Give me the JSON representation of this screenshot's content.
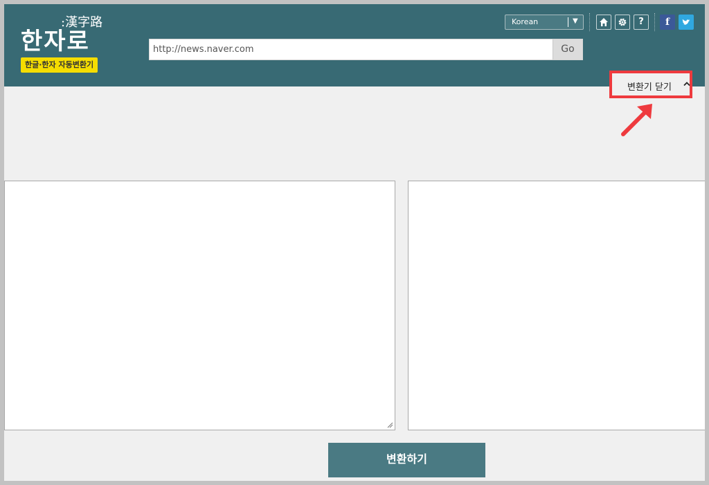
{
  "header": {
    "logo_hanja": ":漢字路",
    "logo_title": "한자로",
    "logo_badge": "한글·한자 자동변환기",
    "url_value": "http://news.naver.com",
    "go_label": "Go",
    "language": {
      "selected": "Korean"
    },
    "icons": [
      "home-icon",
      "gear-icon",
      "help-icon",
      "facebook-icon",
      "twitter-icon"
    ],
    "help_glyph": "?",
    "facebook_glyph": "f"
  },
  "converter": {
    "toggle_label": "변환기 닫기",
    "input_text": "",
    "output_text": "",
    "convert_label": "변환하기"
  },
  "colors": {
    "header_bg": "#386a74",
    "button_bg": "#4a7a83",
    "badge_bg": "#f5dd00",
    "highlight": "#ee3a3e"
  }
}
